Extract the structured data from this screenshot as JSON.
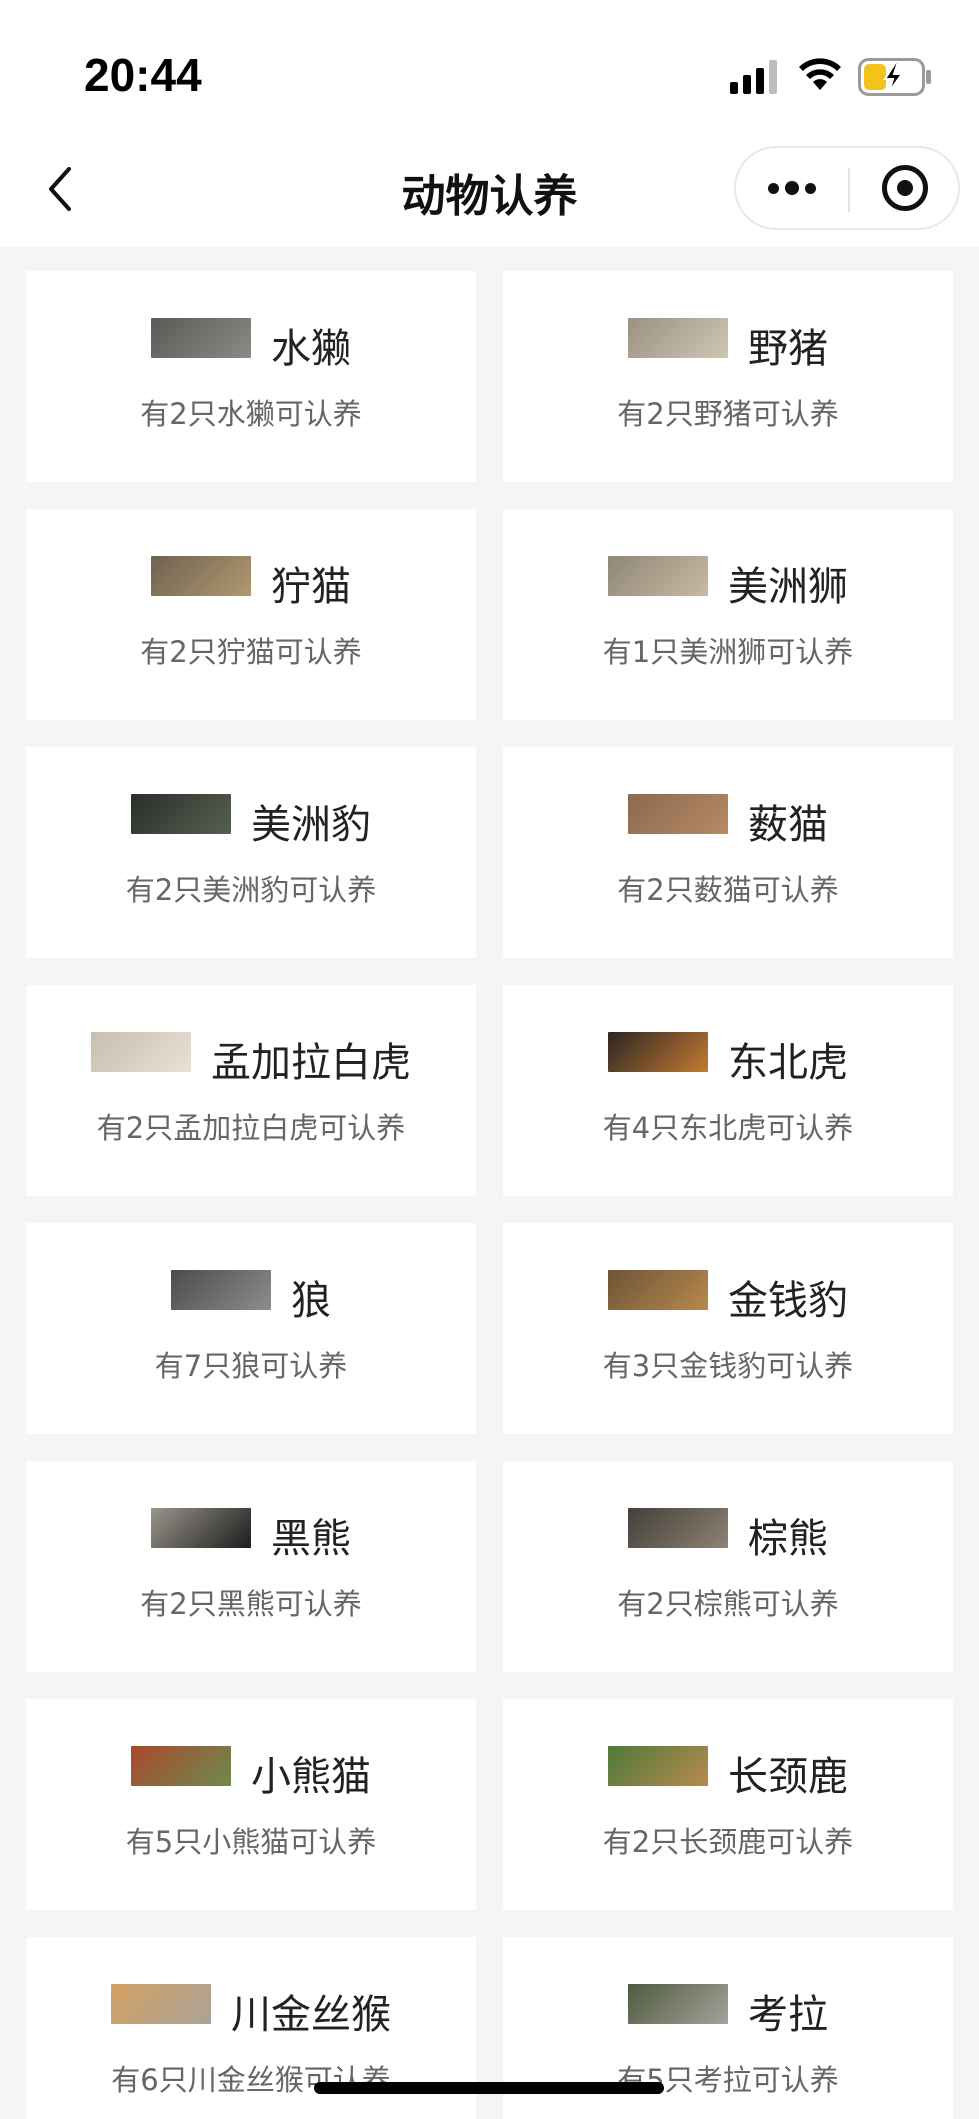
{
  "status_bar": {
    "time": "20:44"
  },
  "nav": {
    "title": "动物认养"
  },
  "animals": [
    {
      "name": "水獭",
      "count_text": "有2只水獭可认养",
      "thumb_colors": [
        "#5a5a56",
        "#8c8a84"
      ]
    },
    {
      "name": "野猪",
      "count_text": "有2只野猪可认养",
      "thumb_colors": [
        "#9a9182",
        "#cfc6b4"
      ]
    },
    {
      "name": "狞猫",
      "count_text": "有2只狞猫可认养",
      "thumb_colors": [
        "#6e6250",
        "#b29870"
      ]
    },
    {
      "name": "美洲狮",
      "count_text": "有1只美洲狮可认养",
      "thumb_colors": [
        "#8e8778",
        "#c9baa0"
      ]
    },
    {
      "name": "美洲豹",
      "count_text": "有2只美洲豹可认养",
      "thumb_colors": [
        "#2a2e2a",
        "#566050"
      ]
    },
    {
      "name": "薮猫",
      "count_text": "有2只薮猫可认养",
      "thumb_colors": [
        "#8b6a50",
        "#b68a64"
      ]
    },
    {
      "name": "孟加拉白虎",
      "count_text": "有2只孟加拉白虎可认养",
      "thumb_colors": [
        "#c7bfae",
        "#e7e1d6"
      ]
    },
    {
      "name": "东北虎",
      "count_text": "有4只东北虎可认养",
      "thumb_colors": [
        "#2b2622",
        "#c47a34"
      ]
    },
    {
      "name": "狼",
      "count_text": "有7只狼可认养",
      "thumb_colors": [
        "#4b4c4c",
        "#8c8e8c"
      ]
    },
    {
      "name": "金钱豹",
      "count_text": "有3只金钱豹可认养",
      "thumb_colors": [
        "#6e5436",
        "#b8894e"
      ]
    },
    {
      "name": "黑熊",
      "count_text": "有2只黑熊可认养",
      "thumb_colors": [
        "#9a958c",
        "#1d1d1d"
      ]
    },
    {
      "name": "棕熊",
      "count_text": "有2只棕熊可认养",
      "thumb_colors": [
        "#44403a",
        "#8e8273"
      ]
    },
    {
      "name": "小熊猫",
      "count_text": "有5只小熊猫可认养",
      "thumb_colors": [
        "#a8492c",
        "#6e8a4e"
      ]
    },
    {
      "name": "长颈鹿",
      "count_text": "有2只长颈鹿可认养",
      "thumb_colors": [
        "#4e7a3a",
        "#b8894e"
      ]
    },
    {
      "name": "川金丝猴",
      "count_text": "有6只川金丝猴可认养",
      "thumb_colors": [
        "#d4a060",
        "#a9a39a"
      ]
    },
    {
      "name": "考拉",
      "count_text": "有5只考拉可认养",
      "thumb_colors": [
        "#4e5a3e",
        "#a6a29a"
      ]
    }
  ]
}
